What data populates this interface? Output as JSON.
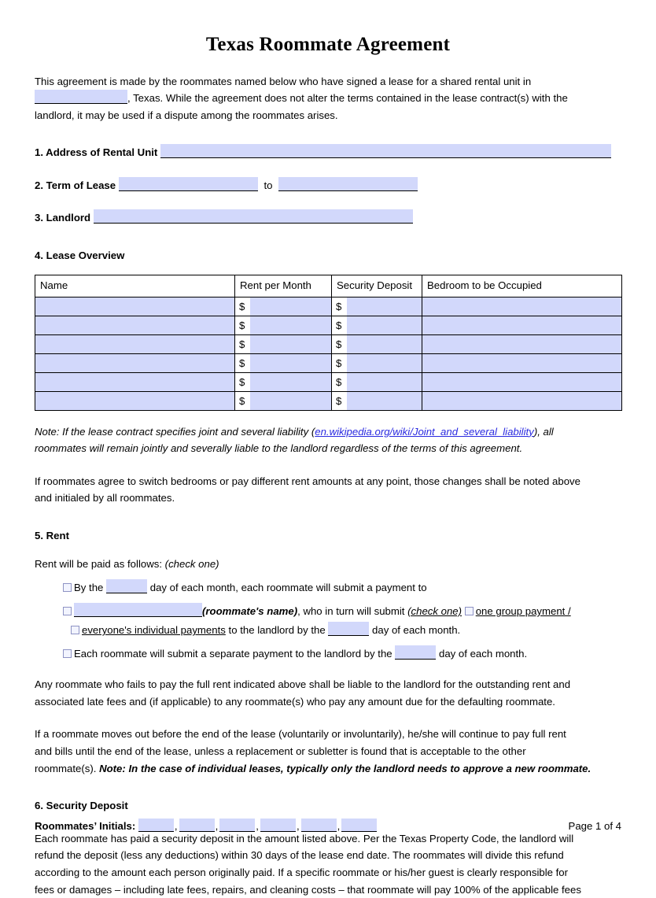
{
  "document": {
    "title": "Texas Roommate Agreement",
    "page_label": "Page 1 of 4"
  },
  "intro": {
    "line1": "This agreement is made by the roommates named below who have signed a lease for a shared rental unit in",
    "after_blank": ", Texas. While the agreement does not alter the terms contained in the lease contract(s) with the",
    "line3": "landlord, it may be used if a dispute among the roommates arises."
  },
  "fields": {
    "address": {
      "label": "1. Address of Rental Unit",
      "value": ""
    },
    "term": {
      "label": "2. Term of Lease",
      "from": "",
      "joiner": "to",
      "to": ""
    },
    "landlord": {
      "label": "3. Landlord",
      "value": ""
    }
  },
  "lease_overview": {
    "heading": "4. Lease Overview",
    "columns": [
      "Name",
      "Rent per Month",
      "Security Deposit",
      "Bedroom to be Occupied"
    ],
    "currency_symbol": "$",
    "rows": [
      {
        "name": "",
        "rent": "",
        "deposit": "",
        "bedroom": ""
      },
      {
        "name": "",
        "rent": "",
        "deposit": "",
        "bedroom": ""
      },
      {
        "name": "",
        "rent": "",
        "deposit": "",
        "bedroom": ""
      },
      {
        "name": "",
        "rent": "",
        "deposit": "",
        "bedroom": ""
      },
      {
        "name": "",
        "rent": "",
        "deposit": "",
        "bedroom": ""
      },
      {
        "name": "",
        "rent": "",
        "deposit": "",
        "bedroom": ""
      }
    ]
  },
  "liability_note": {
    "prefix": "Note: If the lease contract specifies joint and several liability (",
    "link": "en.wikipedia.org/wiki/Joint_and_several_liability",
    "suffix": "), all",
    "line2": "roommates will remain jointly and severally liable to the landlord regardless of the terms of this agreement."
  },
  "switch_bedrooms": {
    "line1": "If roommates agree to switch bedrooms or pay different rent amounts at any point, those changes shall be noted above",
    "line2": "and initialed by all roommates."
  },
  "rent": {
    "heading": "5. Rent",
    "lead_text": "Rent will be paid as follows:",
    "lead_note": "(check one)",
    "option1": {
      "before_blank": "By the",
      "after_blank": "day of each month, each roommate will submit a payment to"
    },
    "option2": {
      "name_label": "(roommate's name)",
      "mid": ", who in turn will submit",
      "check_one": "(check one)",
      "choice_a": "one group payment /",
      "choice_b": "everyone's individual payments",
      "tail_before_blank": "to the landlord by the",
      "tail_after_blank": "day of each month."
    },
    "option3": {
      "before_blank": "Each roommate will submit a separate payment to the landlord by the",
      "after_blank": "day of each month."
    },
    "default_para": {
      "line1": "Any roommate who fails to pay the full rent indicated above shall be liable to the landlord for the outstanding rent and",
      "line2": "associated late fees and (if applicable) to any roommate(s) who pay any amount due for the defaulting roommate."
    },
    "moveout_para": {
      "line1": "If a roommate moves out before the end of the lease (voluntarily or involuntarily), he/she will continue to pay full rent",
      "line2": "and bills until the end of the lease, unless a replacement or subletter is found that is acceptable to the other",
      "line3_prefix": "roommate(s).",
      "line3_note": "Note: In the case of individual leases, typically only the landlord needs to approve a new roommate."
    }
  },
  "security_deposit": {
    "heading": "6. Security Deposit",
    "line1": "Each roommate has paid a security deposit in the amount listed above. Per the Texas Property Code, the landlord will",
    "line2": "refund the deposit (less any deductions) within 30 days of the lease end date. The roommates will divide this refund",
    "line3": "according to the amount each person originally paid. If a specific roommate or his/her guest is clearly responsible for",
    "line4": "fees or damages – including late fees, repairs, and cleaning costs – that roommate will pay 100% of the applicable fees"
  },
  "footer": {
    "initials_label": "Roommates’ Initials:",
    "initials_count": 6,
    "separator": ",",
    "page_label": "Page 1 of 4"
  },
  "colors": {
    "field_fill": "#d2d8fb",
    "link": "#2a2ae0",
    "checkbox_border": "#8e93c4",
    "table_border": "#000000"
  }
}
